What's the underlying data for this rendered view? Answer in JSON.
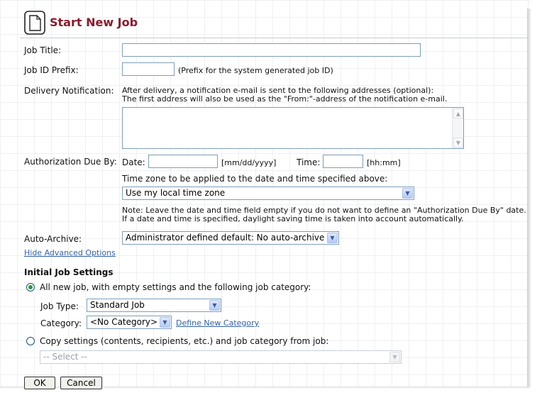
{
  "title": "Start New Job",
  "icons": {
    "title_icon": "document-icon",
    "radio_selected": "radio-selected-icon"
  },
  "colors": {
    "title": "#8b1a2b",
    "link": "#3362a8",
    "radio_dot": "#2a9a2a"
  },
  "fields": {
    "job_title": {
      "label": "Job Title:",
      "value": ""
    },
    "job_id_prefix": {
      "label": "Job ID Prefix:",
      "value": "",
      "hint": "(Prefix for the system generated job ID)"
    },
    "delivery": {
      "label": "Delivery Notification:",
      "note_line1": "After delivery, a notification e-mail is sent to the following addresses (optional):",
      "note_line2": "The first address will also be used as the \"From:\"-address of the notification e-mail.",
      "value": ""
    },
    "auth_due": {
      "label": "Authorization Due By:",
      "date_label": "Date:",
      "date_value": "",
      "date_format": "[mm/dd/yyyy]",
      "time_label": "Time:",
      "time_value": "",
      "time_format": "[hh:mm]",
      "tz_label": "Time zone to be applied to the date and time specified above:",
      "tz_selected": "Use my local time zone",
      "note_line1": "Note: Leave the date and time field empty if you do not want to define an \"Authorization Due By\" date.",
      "note_line2": "If a date and time is specified, daylight saving time is taken into account automatically."
    },
    "auto_archive": {
      "label": "Auto-Archive:",
      "selected": "Administrator defined default: No auto-archive"
    }
  },
  "hide_advanced_link": "Hide Advanced Options",
  "initial_settings": {
    "heading": "Initial Job Settings",
    "option_new": "All new job, with empty settings and the following job category:",
    "job_type_label": "Job Type:",
    "job_type_selected": "Standard Job",
    "category_label": "Category:",
    "category_selected": "<No Category>",
    "define_category_link": "Define New Category",
    "option_copy": "Copy settings (contents, recipients, etc.) and job category from job:",
    "copy_select_placeholder": "-- Select --"
  },
  "buttons": {
    "ok": "OK",
    "cancel": "Cancel"
  }
}
